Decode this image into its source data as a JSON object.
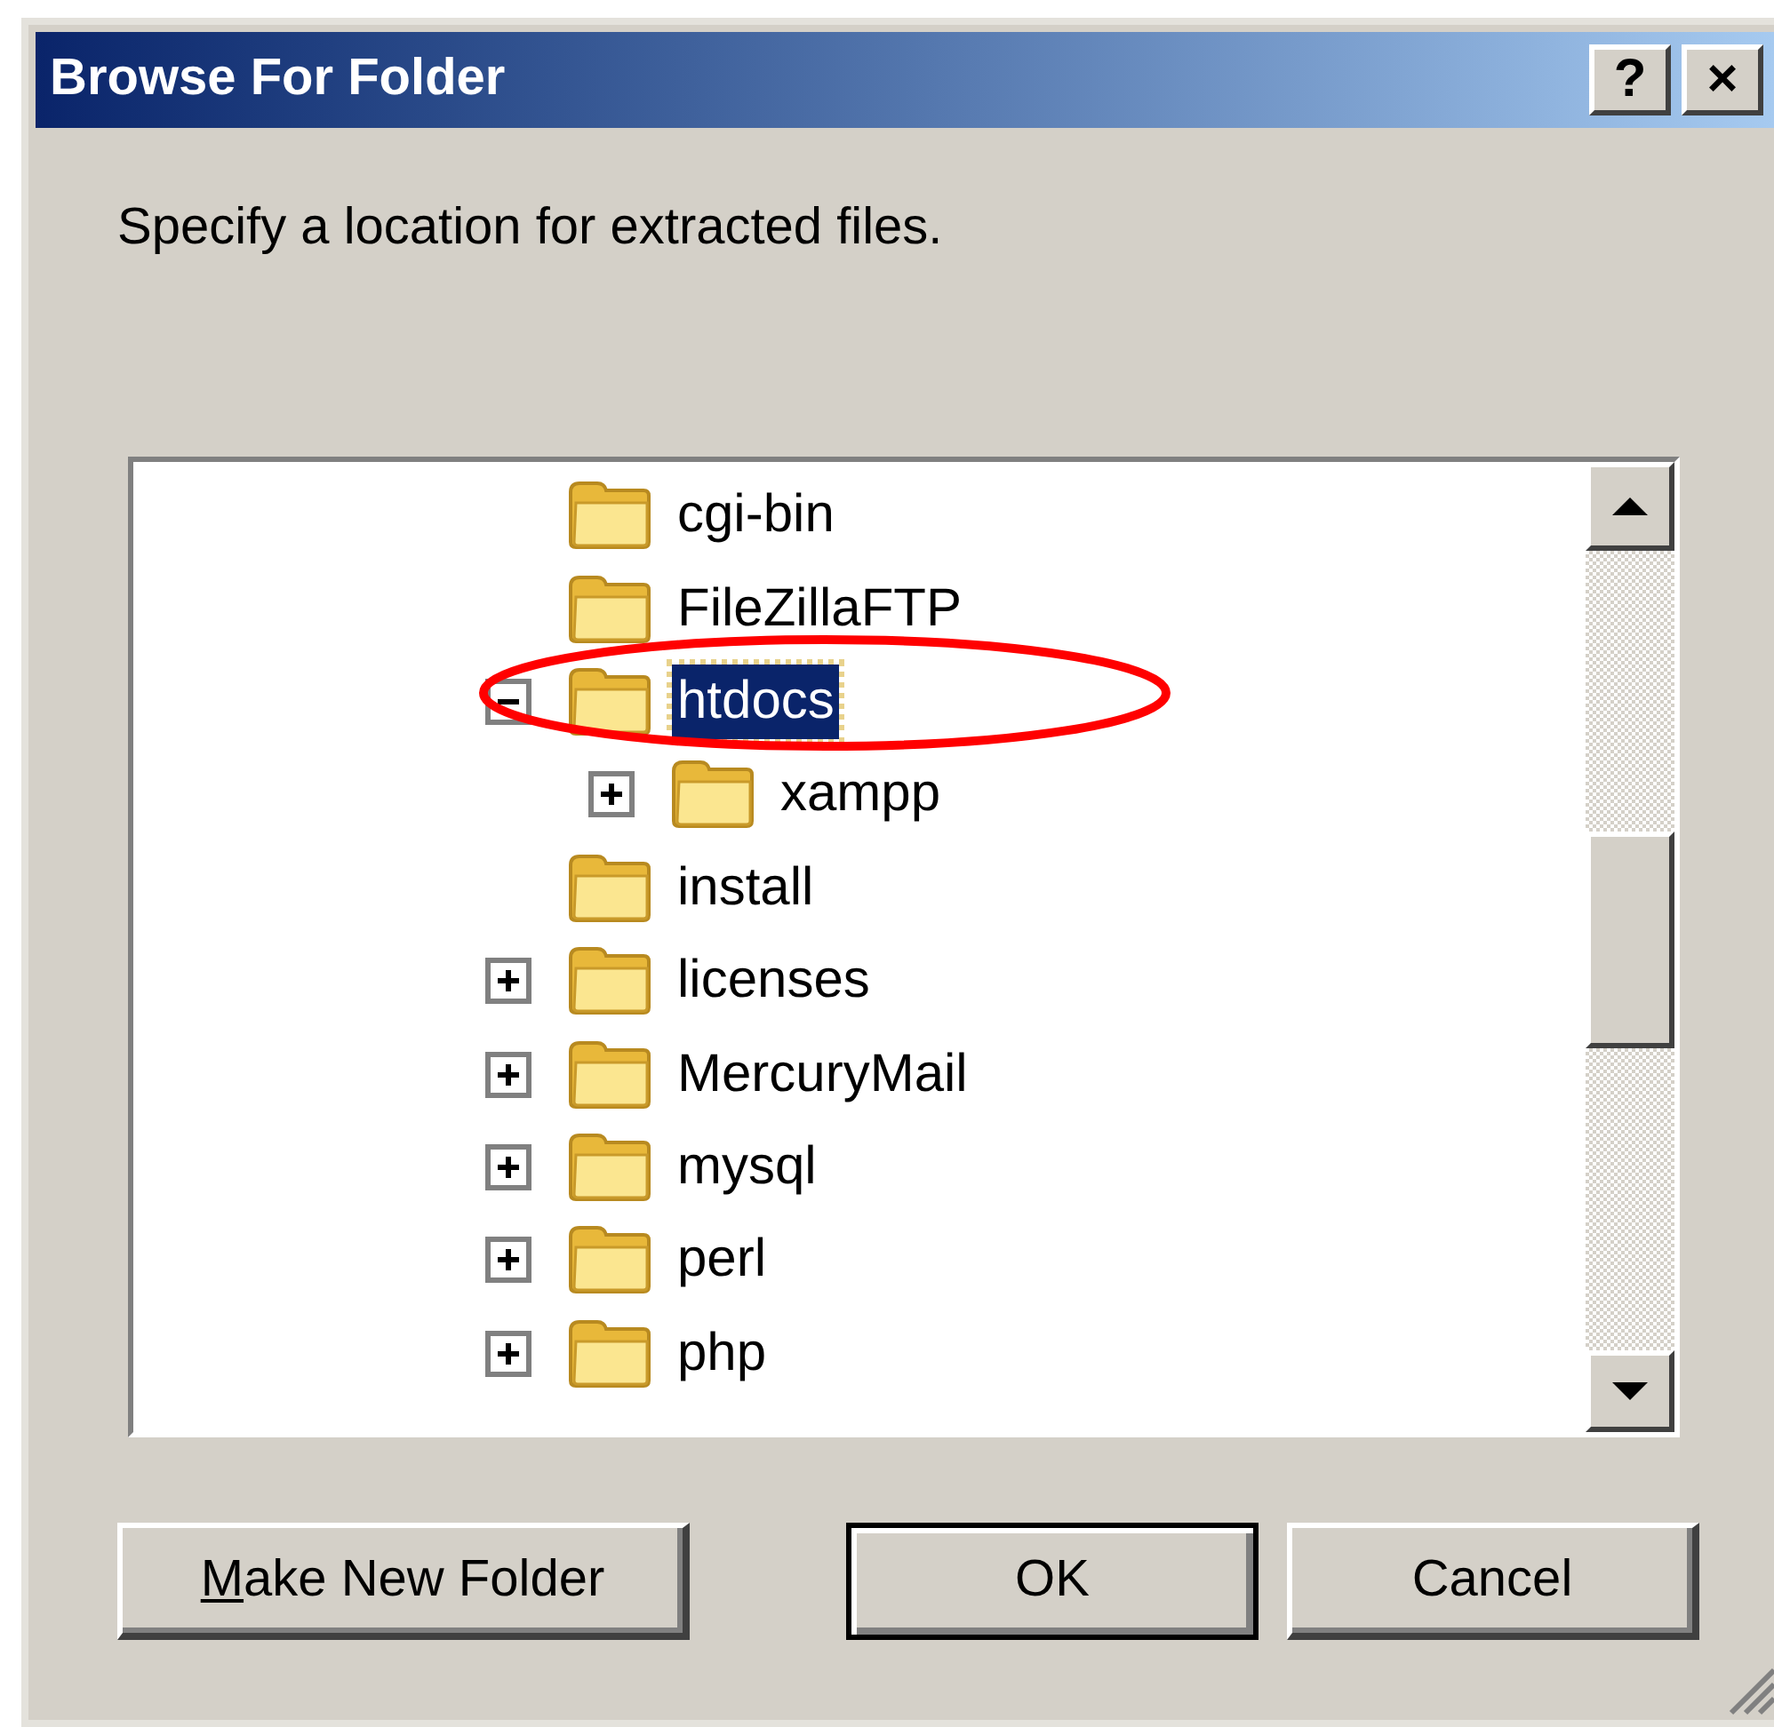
{
  "window": {
    "title": "Browse For Folder",
    "title_buttons": [
      "?",
      "×"
    ]
  },
  "prompt": "Specify a location for extracted files.",
  "tree": [
    {
      "label": "cgi-bin",
      "selected": false
    },
    {
      "label": "FileZillaFTP",
      "selected": false
    },
    {
      "label": "htdocs",
      "expanded": true,
      "selected": true,
      "children": [
        {
          "label": "xampp",
          "expanded": false,
          "selected": false
        }
      ]
    },
    {
      "label": "install",
      "selected": false
    },
    {
      "label": "licenses",
      "expanded": false,
      "selected": false
    },
    {
      "label": "MercuryMail",
      "expanded": false,
      "selected": false
    },
    {
      "label": "mysql",
      "expanded": false,
      "selected": false
    },
    {
      "label": "perl",
      "expanded": false,
      "selected": false
    },
    {
      "label": "php",
      "expanded": false,
      "selected": false
    }
  ],
  "buttons": [
    {
      "label": "Make New Folder",
      "kind": "mnemonic",
      "default": false
    },
    {
      "label": "OK",
      "kind": "plain",
      "default": true
    },
    {
      "label": "Cancel",
      "kind": "plain",
      "default": false
    }
  ]
}
